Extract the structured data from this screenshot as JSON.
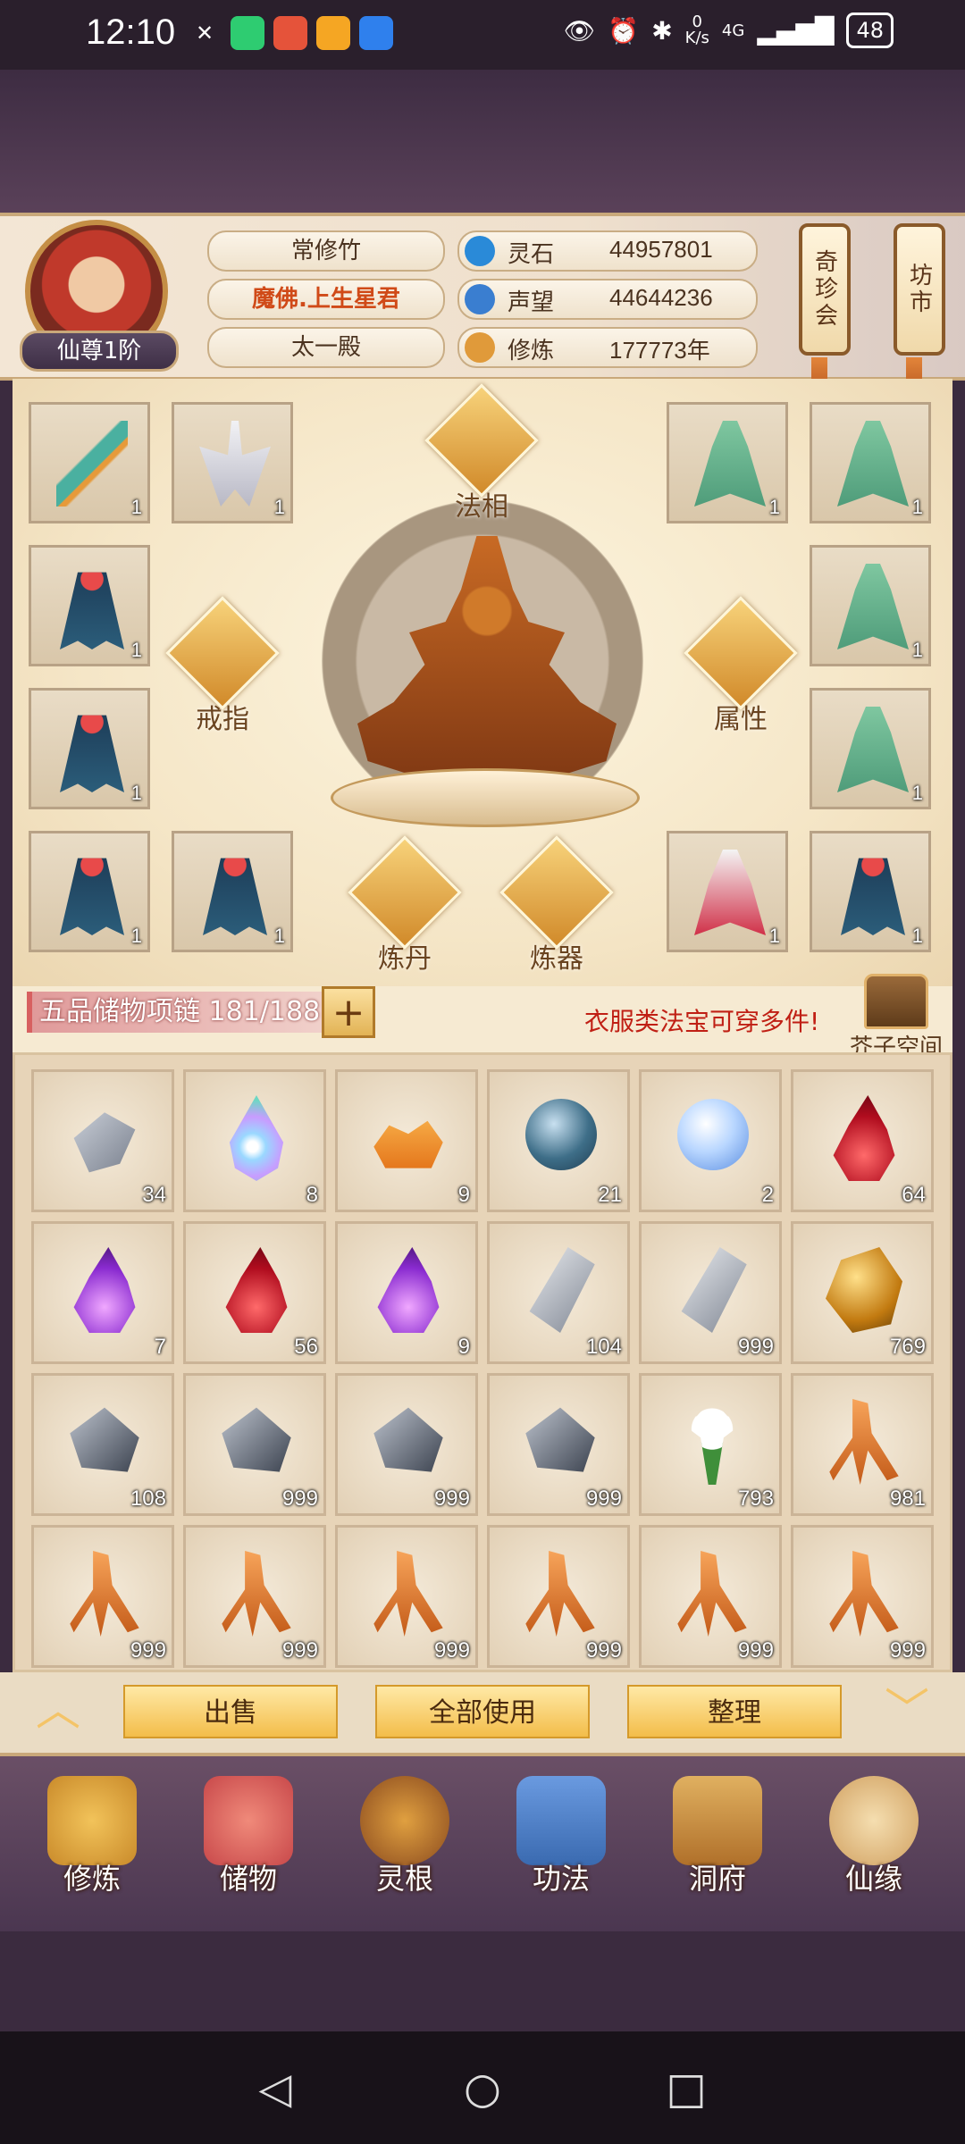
{
  "status_bar": {
    "time": "12:10",
    "net_speed_value": "0",
    "net_speed_unit": "K/s",
    "network": "4G",
    "battery": "48"
  },
  "player": {
    "rank": "仙尊1阶",
    "name": "常修竹",
    "title": "魔佛.上生星君",
    "sect": "太一殿"
  },
  "resources": [
    {
      "label": "灵石",
      "value": "44957801",
      "icon": "spirit-stone-icon",
      "color": "#2a8ad8"
    },
    {
      "label": "声望",
      "value": "44644236",
      "icon": "prestige-icon",
      "color": "#3a7ed0"
    },
    {
      "label": "修炼",
      "value": "177773年",
      "icon": "cultivation-icon",
      "color": "#e09a3a"
    }
  ],
  "side_buttons": {
    "treasure": "奇珍会",
    "market": "坊市"
  },
  "equipment": {
    "center_title": "法相",
    "ring_label": "戒指",
    "attr_label": "属性",
    "alchemy_label": "炼丹",
    "forge_label": "炼器",
    "slots": [
      {
        "art": "art-sword",
        "count": "1"
      },
      {
        "art": "art-white",
        "count": "1"
      },
      {
        "art": "art-green",
        "count": "1"
      },
      {
        "art": "art-green",
        "count": "1"
      },
      {
        "art": "art-blue",
        "count": "1"
      },
      {
        "art": "art-green",
        "count": "1"
      },
      {
        "art": "art-blue",
        "count": "1"
      },
      {
        "art": "art-green",
        "count": "1"
      },
      {
        "art": "art-blue",
        "count": "1"
      },
      {
        "art": "art-blue",
        "count": "1"
      },
      {
        "art": "art-red",
        "count": "1"
      },
      {
        "art": "art-blue",
        "count": "1"
      }
    ]
  },
  "storage": {
    "label": "五品储物项链 181/188",
    "plus": "+",
    "hint": "衣服类法宝可穿多件!",
    "mustard_label": "芥子空间"
  },
  "inventory": [
    {
      "icon": "i-shard",
      "count": "34"
    },
    {
      "icon": "i-drop-rb",
      "count": "8"
    },
    {
      "icon": "i-gold",
      "count": "9"
    },
    {
      "icon": "i-orb-dark",
      "count": "21"
    },
    {
      "icon": "i-orb-light",
      "count": "2"
    },
    {
      "icon": "i-flame-red",
      "count": "64"
    },
    {
      "icon": "i-flame-purple",
      "count": "7"
    },
    {
      "icon": "i-flame-red",
      "count": "56"
    },
    {
      "icon": "i-flame-purple",
      "count": "9"
    },
    {
      "icon": "i-stone-grey",
      "count": "104"
    },
    {
      "icon": "i-stone-grey",
      "count": "999"
    },
    {
      "icon": "i-gold-ore",
      "count": "769"
    },
    {
      "icon": "i-dark-ore",
      "count": "108"
    },
    {
      "icon": "i-dark-ore",
      "count": "999"
    },
    {
      "icon": "i-dark-ore",
      "count": "999"
    },
    {
      "icon": "i-dark-ore",
      "count": "999"
    },
    {
      "icon": "i-flower",
      "count": "793"
    },
    {
      "icon": "i-root",
      "count": "981"
    },
    {
      "icon": "i-root",
      "count": "999"
    },
    {
      "icon": "i-root",
      "count": "999"
    },
    {
      "icon": "i-root",
      "count": "999"
    },
    {
      "icon": "i-root",
      "count": "999"
    },
    {
      "icon": "i-root",
      "count": "999"
    },
    {
      "icon": "i-root",
      "count": "999"
    }
  ],
  "actions": {
    "sell": "出售",
    "use_all": "全部使用",
    "sort": "整理"
  },
  "nav": [
    {
      "label": "修炼",
      "color": "#c98a2a"
    },
    {
      "label": "储物",
      "color": "#c8484a"
    },
    {
      "label": "灵根",
      "color": "#8a4a1e"
    },
    {
      "label": "功法",
      "color": "#3a6ab0"
    },
    {
      "label": "洞府",
      "color": "#b0702a"
    },
    {
      "label": "仙缘",
      "color": "#d0a060"
    }
  ]
}
